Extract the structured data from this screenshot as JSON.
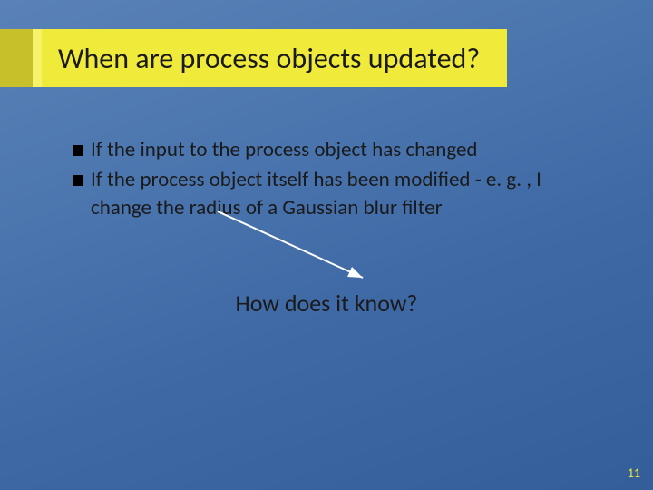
{
  "title": "When are process objects updated?",
  "bullets": [
    "If the input to the process object has changed",
    "If the process object itself has been modified - e. g. , I change the radius of a Gaussian blur filter"
  ],
  "question": "How does it know?",
  "page_number": "11"
}
